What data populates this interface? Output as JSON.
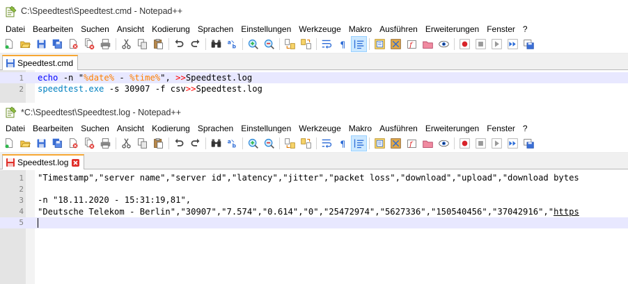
{
  "window1": {
    "title": "C:\\Speedtest\\Speedtest.cmd - Notepad++",
    "menu": [
      "Datei",
      "Bearbeiten",
      "Suchen",
      "Ansicht",
      "Kodierung",
      "Sprachen",
      "Einstellungen",
      "Werkzeuge",
      "Makro",
      "Ausführen",
      "Erweiterungen",
      "Fenster",
      "?"
    ],
    "tab": {
      "label": "Speedtest.cmd",
      "status": "saved"
    },
    "lines": [
      {
        "num": "1",
        "segments": [
          {
            "t": "echo",
            "c": "kw"
          },
          {
            "t": " -n \"",
            "c": "plain"
          },
          {
            "t": "%date%",
            "c": "var"
          },
          {
            "t": " - ",
            "c": "plain"
          },
          {
            "t": "%time%",
            "c": "var"
          },
          {
            "t": "\", ",
            "c": "plain"
          },
          {
            "t": ">>",
            "c": "op"
          },
          {
            "t": "Speedtest.log",
            "c": "plain"
          }
        ]
      },
      {
        "num": "2",
        "segments": [
          {
            "t": "speedtest.exe",
            "c": "cmd"
          },
          {
            "t": " -s 30907 -f csv",
            "c": "plain"
          },
          {
            "t": ">>",
            "c": "op"
          },
          {
            "t": "Speedtest.log",
            "c": "plain"
          }
        ]
      }
    ]
  },
  "window2": {
    "title": "*C:\\Speedtest\\Speedtest.log - Notepad++",
    "menu": [
      "Datei",
      "Bearbeiten",
      "Suchen",
      "Ansicht",
      "Kodierung",
      "Sprachen",
      "Einstellungen",
      "Werkzeuge",
      "Makro",
      "Ausführen",
      "Erweiterungen",
      "Fenster",
      "?"
    ],
    "tab": {
      "label": "Speedtest.log",
      "status": "modified"
    },
    "lines": [
      {
        "num": "1",
        "text": "\"Timestamp\",\"server name\",\"server id\",\"latency\",\"jitter\",\"packet loss\",\"download\",\"upload\",\"download bytes"
      },
      {
        "num": "2",
        "text": ""
      },
      {
        "num": "3",
        "text": "-n \"18.11.2020 - 15:31:19,81\","
      },
      {
        "num": "4",
        "text": "\"Deutsche Telekom - Berlin\",\"30907\",\"7.574\",\"0.614\",\"0\",\"25472974\",\"5627336\",\"150540456\",\"37042916\",\"",
        "link": "https"
      },
      {
        "num": "5",
        "text": ""
      }
    ]
  },
  "toolbar_icons": [
    "new-file-icon",
    "open-file-icon",
    "save-icon",
    "save-all-icon",
    "close-icon",
    "close-all-icon",
    "print-icon",
    "sep",
    "cut-icon",
    "copy-icon",
    "paste-icon",
    "sep",
    "undo-icon",
    "redo-icon",
    "sep",
    "find-icon",
    "replace-icon",
    "sep",
    "zoom-in-icon",
    "zoom-out-icon",
    "sep",
    "sync-vertical-icon",
    "sync-horizontal-icon",
    "sep",
    "word-wrap-icon",
    "show-all-chars-icon",
    "indent-guide-icon",
    "sep",
    "document-map-icon",
    "function-list-icon",
    "folder-as-workspace-icon",
    "monitoring-icon",
    "sep",
    "record-macro-icon",
    "stop-macro-icon",
    "play-macro-icon",
    "run-macro-multiple-icon",
    "save-macro-icon"
  ],
  "colors": {
    "tab_accent": "#f7a733",
    "current_line": "#e8e8ff",
    "keyword": "#0000ff",
    "variable": "#ff8000",
    "operator": "#ff0000",
    "command": "#0080c0"
  }
}
